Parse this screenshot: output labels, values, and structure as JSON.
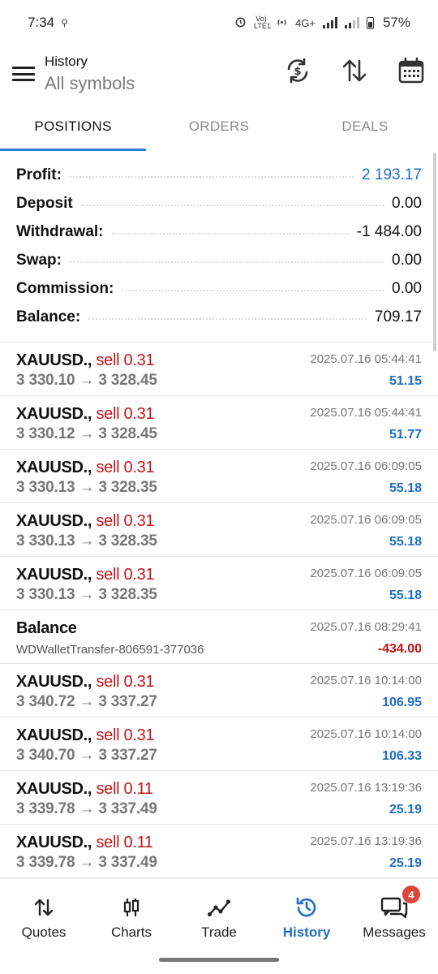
{
  "status": {
    "time": "7:34",
    "volte": "Vo) LTE1",
    "network": "4G+",
    "battery": "57%"
  },
  "header": {
    "title": "History",
    "subtitle": "All symbols",
    "icons": [
      "sync-currency-icon",
      "sort-icon",
      "calendar-icon"
    ]
  },
  "tabs": [
    {
      "label": "POSITIONS",
      "active": true
    },
    {
      "label": "ORDERS",
      "active": false
    },
    {
      "label": "DEALS",
      "active": false
    }
  ],
  "summary": [
    {
      "label": "Profit:",
      "value": "2 193.17",
      "color": "#1f6fc4"
    },
    {
      "label": "Deposit",
      "value": "0.00"
    },
    {
      "label": "Withdrawal:",
      "value": "-1 484.00"
    },
    {
      "label": "Swap:",
      "value": "0.00"
    },
    {
      "label": "Commission:",
      "value": "0.00"
    },
    {
      "label": "Balance:",
      "value": "709.17"
    }
  ],
  "trades": [
    {
      "symbol": "XAUUSD.,",
      "side": "sell 0.31",
      "open": "3 330.10",
      "arrow": "→",
      "close": "3 328.45",
      "time": "2025.07.16 05:44:41",
      "profit": "51.15"
    },
    {
      "symbol": "XAUUSD.,",
      "side": "sell 0.31",
      "open": "3 330.12",
      "arrow": "→",
      "close": "3 328.45",
      "time": "2025.07.16 05:44:41",
      "profit": "51.77"
    },
    {
      "symbol": "XAUUSD.,",
      "side": "sell 0.31",
      "open": "3 330.13",
      "arrow": "→",
      "close": "3 328.35",
      "time": "2025.07.16 06:09:05",
      "profit": "55.18"
    },
    {
      "symbol": "XAUUSD.,",
      "side": "sell 0.31",
      "open": "3 330.13",
      "arrow": "→",
      "close": "3 328.35",
      "time": "2025.07.16 06:09:05",
      "profit": "55.18"
    },
    {
      "symbol": "XAUUSD.,",
      "side": "sell 0.31",
      "open": "3 330.13",
      "arrow": "→",
      "close": "3 328.35",
      "time": "2025.07.16 06:09:05",
      "profit": "55.18"
    },
    {
      "symbol": "Balance",
      "comment": "WDWalletTransfer-806591-377036",
      "time": "2025.07.16 08:29:41",
      "profit": "-434.00"
    },
    {
      "symbol": "XAUUSD.,",
      "side": "sell 0.31",
      "open": "3 340.72",
      "arrow": "→",
      "close": "3 337.27",
      "time": "2025.07.16 10:14:00",
      "profit": "106.95"
    },
    {
      "symbol": "XAUUSD.,",
      "side": "sell 0.31",
      "open": "3 340.70",
      "arrow": "→",
      "close": "3 337.27",
      "time": "2025.07.16 10:14:00",
      "profit": "106.33"
    },
    {
      "symbol": "XAUUSD.,",
      "side": "sell 0.11",
      "open": "3 339.78",
      "arrow": "→",
      "close": "3 337.49",
      "time": "2025.07.16 13:19:36",
      "profit": "25.19"
    },
    {
      "symbol": "XAUUSD.,",
      "side": "sell 0.11",
      "open": "3 339.78",
      "arrow": "→",
      "close": "3 337.49",
      "time": "2025.07.16 13:19:36",
      "profit": "25.19"
    }
  ],
  "colors": {
    "accent": "#1f6fc4",
    "sell": "#c0161b",
    "tab_indicator": "#2a7fd4",
    "badge": "#e0453a"
  },
  "nav": [
    {
      "label": "Quotes",
      "icon": "quotes-icon"
    },
    {
      "label": "Charts",
      "icon": "charts-icon"
    },
    {
      "label": "Trade",
      "icon": "trade-icon"
    },
    {
      "label": "History",
      "icon": "history-icon",
      "active": true
    },
    {
      "label": "Messages",
      "icon": "messages-icon",
      "badge": "4"
    }
  ]
}
